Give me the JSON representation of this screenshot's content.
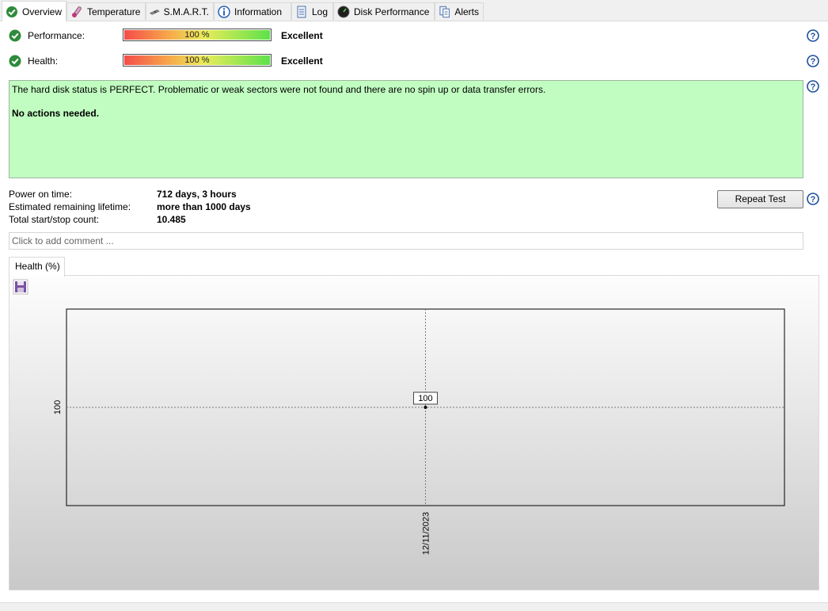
{
  "tabs": [
    {
      "label": "Overview",
      "icon": "check-circle-icon"
    },
    {
      "label": "Temperature",
      "icon": "thermometer-icon"
    },
    {
      "label": "S.M.A.R.T.",
      "icon": "disk-icon"
    },
    {
      "label": "Information",
      "icon": "info-icon"
    },
    {
      "label": "Log",
      "icon": "log-document-icon"
    },
    {
      "label": "Disk Performance",
      "icon": "gauge-icon"
    },
    {
      "label": "Alerts",
      "icon": "alerts-document-icon"
    }
  ],
  "performance": {
    "label": "Performance:",
    "percent_text": "100 %",
    "rating": "Excellent",
    "value": 100
  },
  "health": {
    "label": "Health:",
    "percent_text": "100 %",
    "rating": "Excellent",
    "value": 100
  },
  "status": {
    "message": "The hard disk status is PERFECT. Problematic or weak sectors were not found and there are no spin up or data transfer errors.",
    "action": "No actions needed.",
    "color": "#c1fdc1"
  },
  "info": [
    {
      "label": "Power on time:",
      "value": "712 days, 3 hours"
    },
    {
      "label": "Estimated remaining lifetime:",
      "value": "more than 1000 days"
    },
    {
      "label": "Total start/stop count:",
      "value": "10.485"
    }
  ],
  "repeat_test_label": "Repeat Test",
  "comment_placeholder": "Click to add comment ...",
  "chart_tab_label": "Health (%)",
  "chart_data": {
    "type": "line",
    "x": [
      "12/11/2023"
    ],
    "series": [
      {
        "values": [
          100
        ]
      }
    ],
    "yticks": [
      "100"
    ],
    "data_labels": [
      "100"
    ],
    "grid": "dotted crosshair through the single point"
  }
}
